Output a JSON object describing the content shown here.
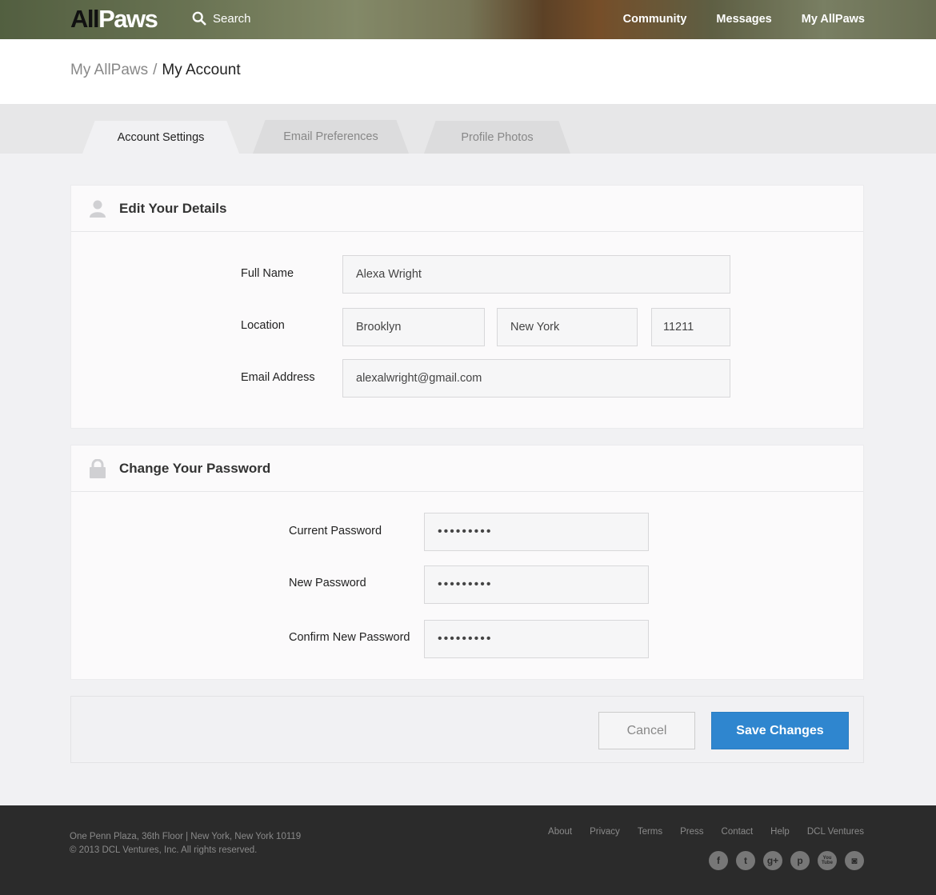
{
  "header": {
    "logo_all": "All",
    "logo_paws": "Paws",
    "search_label": "Search",
    "nav": [
      "Community",
      "Messages",
      "My AllPaws"
    ]
  },
  "breadcrumb": {
    "parent": "My AllPaws",
    "separator": "/",
    "current": "My Account"
  },
  "tabs": [
    {
      "label": "Account Settings",
      "active": true
    },
    {
      "label": "Email Preferences",
      "active": false
    },
    {
      "label": "Profile Photos",
      "active": false
    }
  ],
  "details": {
    "title": "Edit Your Details",
    "full_name_label": "Full Name",
    "full_name": "Alexa Wright",
    "location_label": "Location",
    "city": "Brooklyn",
    "state": "New York",
    "zip": "11211",
    "email_label": "Email Address",
    "email": "alexalwright@gmail.com"
  },
  "password": {
    "title": "Change Your Password",
    "current_label": "Current Password",
    "current_value": "•••••••••",
    "new_label": "New Password",
    "new_value": "•••••••••",
    "confirm_label": "Confirm New Password",
    "confirm_value": "•••••••••"
  },
  "actions": {
    "cancel": "Cancel",
    "save": "Save Changes"
  },
  "footer": {
    "address": "One Penn Plaza, 36th Floor | New York, New York 10119",
    "copyright": "© 2013 DCL Ventures, Inc. All rights reserved.",
    "links": [
      "About",
      "Privacy",
      "Terms",
      "Press",
      "Contact",
      "Help",
      "DCL Ventures"
    ],
    "social": [
      {
        "icon": "facebook-icon",
        "glyph": "f"
      },
      {
        "icon": "twitter-icon",
        "glyph": "t"
      },
      {
        "icon": "googleplus-icon",
        "glyph": "g+"
      },
      {
        "icon": "pinterest-icon",
        "glyph": "p"
      },
      {
        "icon": "youtube-icon",
        "glyph": "You Tube"
      },
      {
        "icon": "instagram-icon",
        "glyph": "◙"
      }
    ]
  },
  "colors": {
    "accent": "#2f86cf",
    "footer_bg": "#2b2b2b",
    "page_bg": "#f1f1f3"
  }
}
